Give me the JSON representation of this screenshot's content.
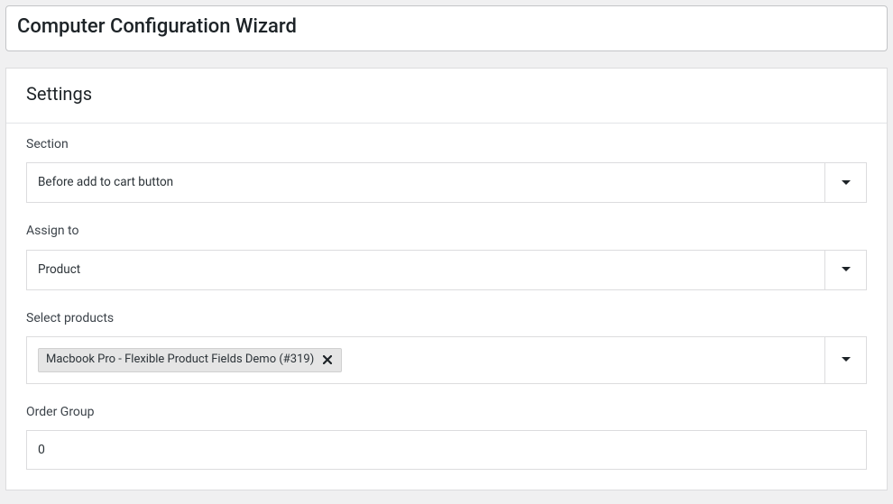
{
  "page_title": "Computer Configuration Wizard",
  "settings": {
    "header": "Settings",
    "section": {
      "label": "Section",
      "value": "Before add to cart button"
    },
    "assign_to": {
      "label": "Assign to",
      "value": "Product"
    },
    "select_products": {
      "label": "Select products",
      "chip": "Macbook Pro - Flexible Product Fields Demo (#319)"
    },
    "order_group": {
      "label": "Order Group",
      "value": "0"
    }
  }
}
